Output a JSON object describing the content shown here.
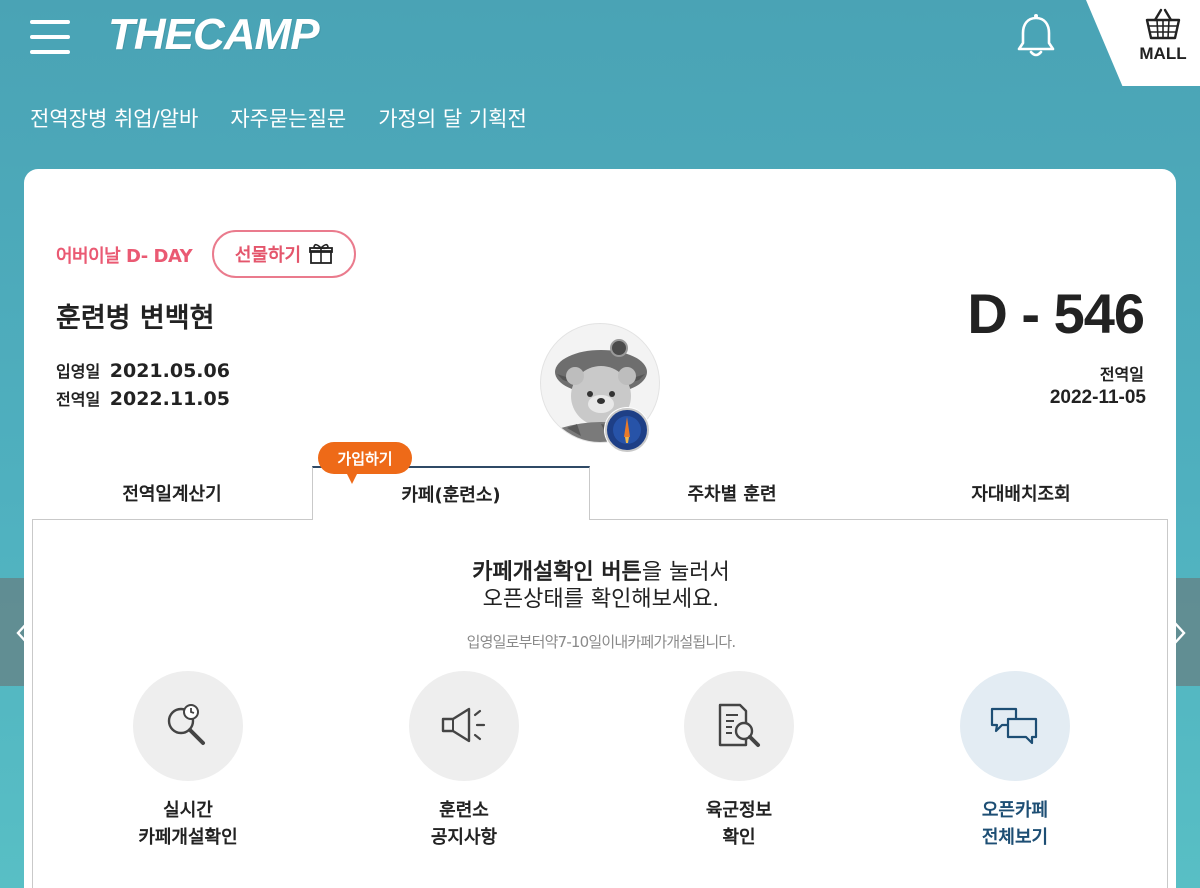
{
  "header": {
    "logo": "THECAMP",
    "mall_label": "MALL"
  },
  "subnav": [
    "전역장병 취업/알바",
    "자주묻는질문",
    "가정의 달 기획전"
  ],
  "profile": {
    "dday_event": "어버이날 D- DAY",
    "gift_button": "선물하기",
    "name": "훈련병 변백현",
    "enlist_label": "입영일",
    "enlist_date": "2021.05.06",
    "discharge_label": "전역일",
    "discharge_date": "2022.11.05",
    "d_counter": "D - 546",
    "discharge_label_right": "전역일",
    "discharge_date_right": "2022-11-05"
  },
  "join_bubble": "가입하기",
  "tabs": [
    "전역일계산기",
    "카페(훈련소)",
    "주차별 훈련",
    "자대배치조회"
  ],
  "active_tab_index": 1,
  "panel": {
    "headline_bold": "카페개설확인 버튼",
    "headline_rest": "을 눌러서",
    "headline_line2": "오픈상태를 확인해보세요.",
    "subnote": "입영일로부터약7-10일이내카페가개설됩니다."
  },
  "functions": [
    {
      "line1": "실시간",
      "line2": "카페개설확인",
      "icon": "magnifier-clock-icon"
    },
    {
      "line1": "훈련소",
      "line2": "공지사항",
      "icon": "megaphone-icon"
    },
    {
      "line1": "육군정보",
      "line2": "확인",
      "icon": "document-search-icon"
    },
    {
      "line1": "오픈카페",
      "line2": "전체보기",
      "icon": "chat-bubbles-icon"
    }
  ],
  "colors": {
    "background": "#4fb0bf",
    "accent_pink": "#ea5a73",
    "accent_orange": "#ee6a18",
    "accent_navy": "#1d4e74"
  }
}
